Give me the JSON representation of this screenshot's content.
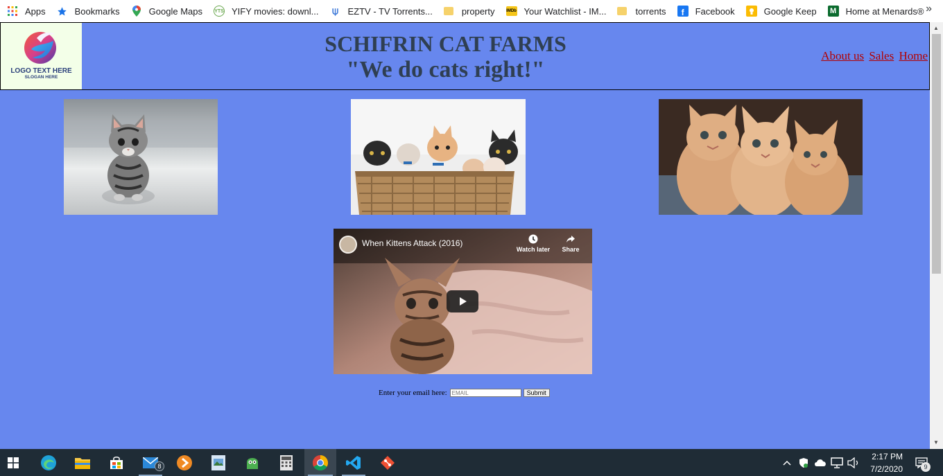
{
  "bookmarks": {
    "items": [
      {
        "label": "Apps",
        "icon": "apps-grid-icon"
      },
      {
        "label": "Bookmarks",
        "icon": "star-icon"
      },
      {
        "label": "Google Maps",
        "icon": "maps-pin-icon"
      },
      {
        "label": "YIFY movies: downl...",
        "icon": "yify-icon"
      },
      {
        "label": "EZTV - TV Torrents...",
        "icon": "eztv-icon"
      },
      {
        "label": "property",
        "icon": "folder-icon"
      },
      {
        "label": "Your Watchlist - IM...",
        "icon": "imdb-icon"
      },
      {
        "label": "torrents",
        "icon": "folder-icon"
      },
      {
        "label": "Facebook",
        "icon": "facebook-icon"
      },
      {
        "label": "Google Keep",
        "icon": "keep-icon"
      },
      {
        "label": "Home at Menards®",
        "icon": "menards-icon"
      }
    ],
    "more": "»"
  },
  "site": {
    "logo_text": "LOGO TEXT HERE",
    "logo_slogan": "SLOGAN HERE",
    "title": "SCHIFRIN CAT FARMS",
    "slogan": "\"We do cats right!\"",
    "nav": [
      "About us",
      "Sales",
      "Home"
    ]
  },
  "video": {
    "title": "When Kittens Attack (2016)",
    "watch_later": "Watch later",
    "share": "Share"
  },
  "form": {
    "label": "Enter your email here:",
    "placeholder": "EMAIL",
    "submit": "Submit"
  },
  "taskbar": {
    "mail_count": "8",
    "time": "2:17 PM",
    "date": "7/2/2020",
    "notification_count": "9"
  },
  "colors": {
    "page_background": "#6787ee",
    "nav_link": "#b30000",
    "title_text": "#2f3f52"
  }
}
